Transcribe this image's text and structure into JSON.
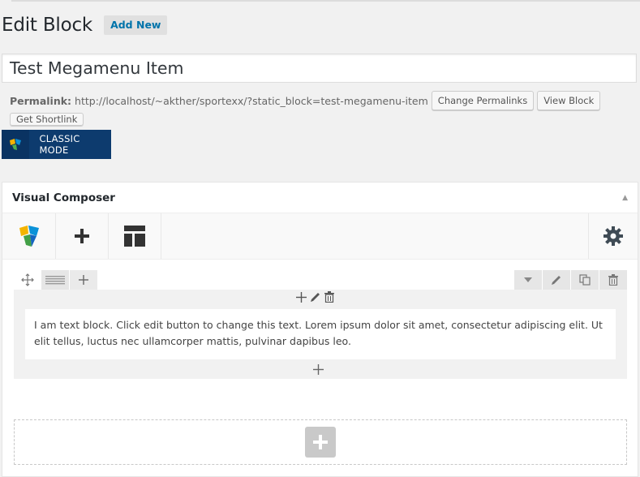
{
  "header": {
    "title": "Edit Block",
    "add_new_label": "Add New"
  },
  "post": {
    "title_value": "Test Megamenu Item"
  },
  "permalink": {
    "label": "Permalink:",
    "url": "http://localhost/~akther/sportexx/?static_block=test-megamenu-item",
    "change_label": "Change Permalinks",
    "view_label": "View Block",
    "shortlink_label": "Get Shortlink"
  },
  "editor_mode": {
    "classic_label": "CLASSIC MODE"
  },
  "visual_composer": {
    "panel_title": "Visual Composer",
    "toolbar": [
      {
        "icon": "vc-logo-icon"
      },
      {
        "icon": "plus-icon"
      },
      {
        "icon": "templates-icon"
      },
      {
        "icon": "gear-icon"
      }
    ],
    "text_block_content": "I am text block. Click edit button to change this text. Lorem ipsum dolor sit amet, consectetur adipiscing elit. Ut elit tellus, luctus nec ullamcorper mattis, pulvinar dapibus leo."
  },
  "colors": {
    "link_blue": "#0073aa",
    "classic_mode_bg": "#0d3b6e",
    "panel_bg": "#ffffff",
    "page_bg": "#f1f1f1"
  }
}
